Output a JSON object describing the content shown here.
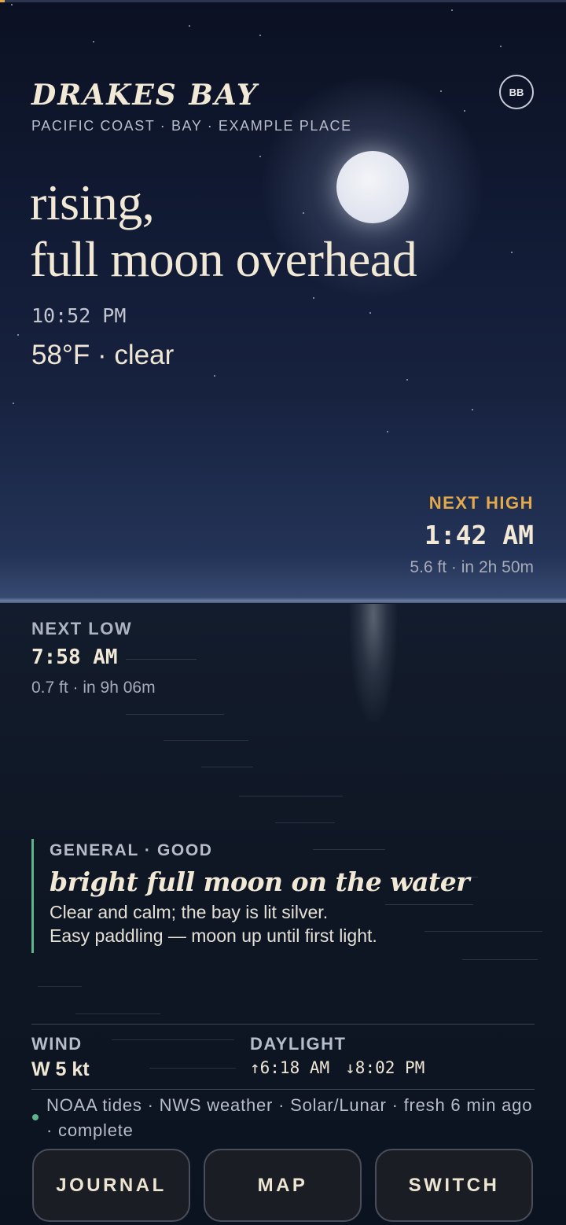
{
  "header": {
    "title": "DRAKES BAY",
    "subtitle": "PACIFIC COAST · BAY · EXAMPLE PLACE",
    "avatar_initials": "BB"
  },
  "hero": {
    "headline_line1": "rising,",
    "headline_line2": "full moon overhead",
    "time": "10:52 PM",
    "weather": "58°F · clear"
  },
  "tides": {
    "next_high": {
      "label": "NEXT HIGH",
      "time": "1:42 AM",
      "detail": "5.6 ft · in 2h 50m"
    },
    "next_low": {
      "label": "NEXT LOW",
      "time": "7:58 AM",
      "detail": "0.7 ft · in 9h 06m"
    }
  },
  "forecast": {
    "tag": "GENERAL · GOOD",
    "title": "bright full moon on the water",
    "line1": "Clear and calm; the bay is lit silver.",
    "line2": "Easy paddling — moon up until first light."
  },
  "stats": {
    "wind_label": "WIND",
    "wind_value": "W 5 kt",
    "daylight_label": "DAYLIGHT",
    "sunrise": "↑6:18 AM",
    "sunset": "↓8:02 PM"
  },
  "sources": "NOAA tides · NWS weather · Solar/Lunar · fresh 6 min ago · complete",
  "buttons": {
    "journal": "JOURNAL",
    "map": "MAP",
    "switch": "SWITCH"
  },
  "colors": {
    "accent_amber": "#e3a94a",
    "status_green": "#5fb58a",
    "background": "#0b1220"
  }
}
